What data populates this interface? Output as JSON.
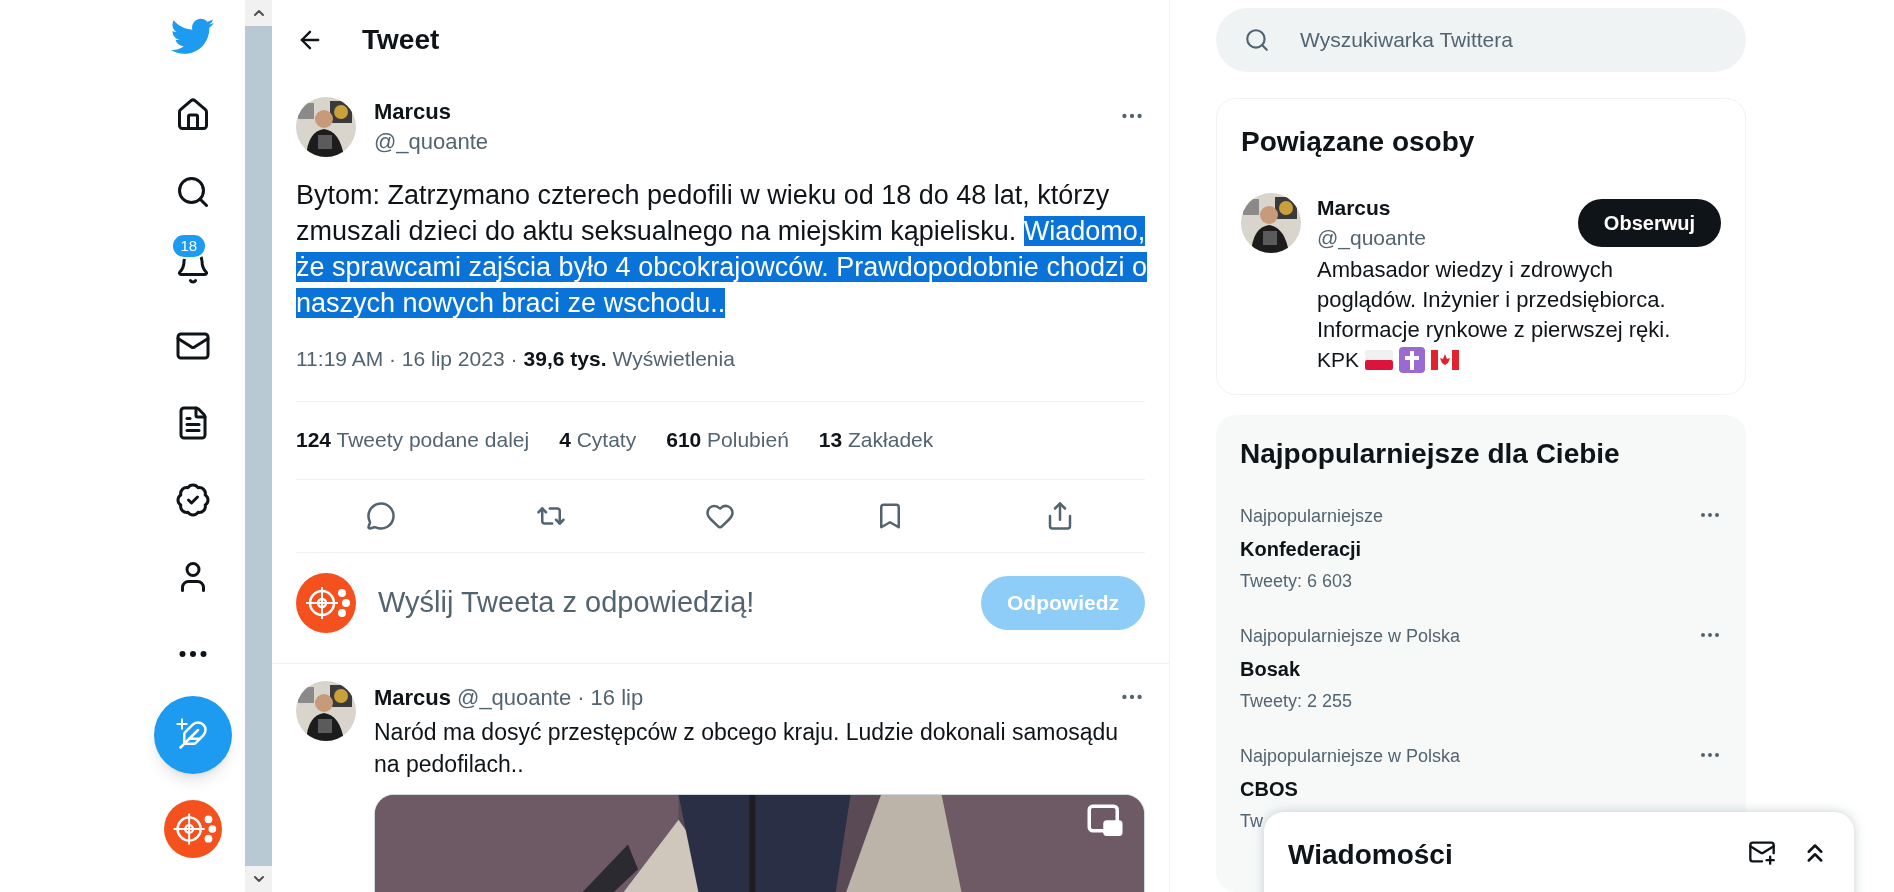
{
  "nav": {
    "notifications_badge": "18"
  },
  "header": {
    "title": "Tweet"
  },
  "tweet": {
    "name": "Marcus",
    "handle": "@_quoante",
    "text_parts": [
      {
        "text": "Bytom: Zatrzymano czterech pedofili w wieku od 18 do 48 lat, którzy zmuszali dzieci do aktu seksualnego na miejskim kąpielisku. ",
        "highlighted": false
      },
      {
        "text": "Wiadomo, że sprawcami zajścia było 4 obcokrajowców. Prawdopodobnie chodzi o naszych nowych braci ze wschodu..",
        "highlighted": true
      }
    ],
    "time": "11:19 AM · 16 lip 2023",
    "separator": "·",
    "views_count": "39,6 tys.",
    "views_label": "Wyświetlenia",
    "stats": [
      {
        "count": "124",
        "label": "Tweety podane dalej"
      },
      {
        "count": "4",
        "label": "Cytaty"
      },
      {
        "count": "610",
        "label": "Polubień"
      },
      {
        "count": "13",
        "label": "Zakładek"
      }
    ]
  },
  "reply": {
    "placeholder": "Wyślij Tweeta z odpowiedzią!",
    "button": "Odpowiedz",
    "disabled": true
  },
  "thread_reply": {
    "name": "Marcus",
    "handle": "@_quoante",
    "date": "· 16 lip",
    "text": "Naród ma dosyć przestępców z obcego kraju. Ludzie dokonali samosądu na pedofilach.."
  },
  "search": {
    "placeholder": "Wyszukiwarka Twittera"
  },
  "related": {
    "title": "Powiązane osoby",
    "people": [
      {
        "name": "Marcus",
        "handle": "@_quoante",
        "button": "Obserwuj",
        "bio": "Ambasador wiedzy i zdrowych poglądów. Inżynier i przedsiębiorca. Informacje rynkowe z pierwszej ręki.",
        "bio_tail": "KPK"
      }
    ]
  },
  "trends": {
    "title": "Najpopularniejsze dla Ciebie",
    "items": [
      {
        "context": "Najpopularniejsze",
        "topic": "Konfederacji",
        "count": "Tweety: 6 603"
      },
      {
        "context": "Najpopularniejsze w Polska",
        "topic": "Bosak",
        "count": "Tweety: 2 255"
      },
      {
        "context": "Najpopularniejsze w Polska",
        "topic": "CBOS",
        "count": "Tw"
      }
    ]
  },
  "messages": {
    "title": "Wiadomości"
  }
}
